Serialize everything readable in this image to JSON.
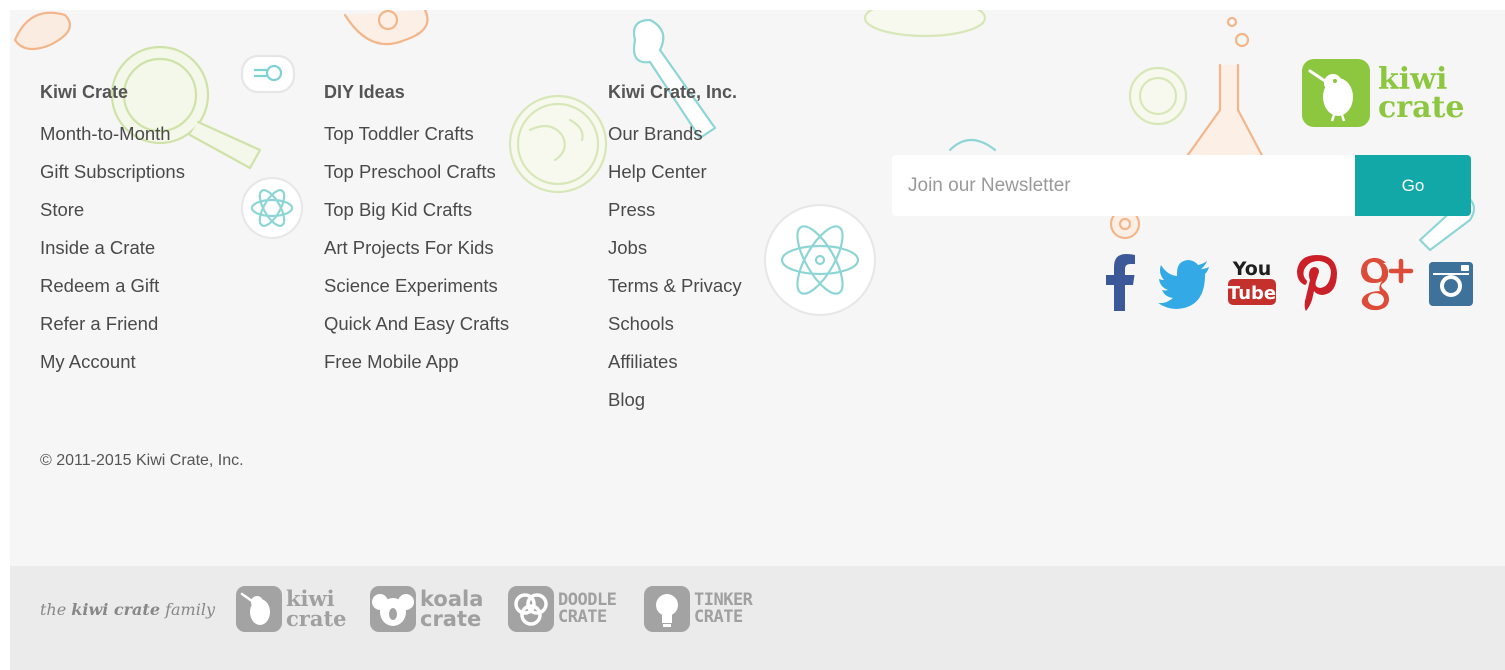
{
  "columns": [
    {
      "title": "Kiwi Crate",
      "links": [
        "Month-to-Month",
        "Gift Subscriptions",
        "Store",
        "Inside a Crate",
        "Redeem a Gift",
        "Refer a Friend",
        "My Account"
      ]
    },
    {
      "title": "DIY Ideas",
      "links": [
        "Top Toddler Crafts",
        "Top Preschool Crafts",
        "Top Big Kid Crafts",
        "Art Projects For Kids",
        "Science Experiments",
        "Quick And Easy Crafts",
        "Free Mobile App"
      ]
    },
    {
      "title": "Kiwi Crate, Inc.",
      "links": [
        "Our Brands",
        "Help Center",
        "Press",
        "Jobs",
        "Terms & Privacy",
        "Schools",
        "Affiliates",
        "Blog"
      ]
    }
  ],
  "copyright": "© 2011-2015 Kiwi Crate, Inc.",
  "brand_logo": {
    "line1": "kiwi",
    "line2": "crate",
    "icon": "kiwi-bird-icon"
  },
  "newsletter": {
    "placeholder": "Join our Newsletter",
    "button_label": "Go"
  },
  "social": {
    "icons": [
      "facebook-icon",
      "twitter-icon",
      "youtube-icon",
      "pinterest-icon",
      "google-plus-icon",
      "instagram-icon"
    ],
    "youtube_you": "You",
    "youtube_tube": "Tube"
  },
  "family": {
    "label_the": "the",
    "label_brand": "kiwi crate",
    "label_family": "family",
    "brands": [
      {
        "line1": "kiwi",
        "line2": "crate",
        "icon": "kiwi-bird-icon"
      },
      {
        "line1": "koala",
        "line2": "crate",
        "icon": "koala-icon"
      },
      {
        "line1": "DOODLE",
        "line2": "CRATE",
        "icon": "doodle-circles-icon"
      },
      {
        "line1": "TINKER",
        "line2": "CRATE",
        "icon": "lightbulb-icon"
      }
    ]
  },
  "colors": {
    "brand_green": "#8dc63f",
    "teal_button": "#12a8a8",
    "facebook": "#3b5998",
    "twitter": "#33a9e6",
    "youtube": "#c4302b",
    "pinterest": "#cb2027",
    "google_plus": "#dd4b39",
    "instagram": "#3f729b",
    "family_gray": "#a3a3a3"
  }
}
